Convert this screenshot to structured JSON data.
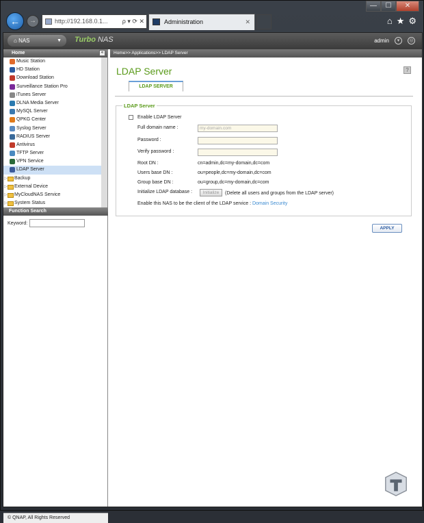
{
  "browser": {
    "address": "http://192.168.0.1...",
    "address_controls": "ρ ▾ ⟳ ✕",
    "tab_title": "Administration",
    "tab_close": "✕",
    "back_icon": "back-arrow-icon",
    "window_controls": [
      "—",
      "☐",
      "✕"
    ],
    "toolbar_icons": [
      "⌂",
      "★",
      "⚙"
    ]
  },
  "header": {
    "nas_button": "NAS",
    "logo_turbo": "Turbo",
    "logo_nas": "NAS",
    "user": "admin"
  },
  "sidebar": {
    "title": "Home",
    "apps": [
      {
        "label": "Music Station",
        "color": "#e06a2a"
      },
      {
        "label": "HD Station",
        "color": "#2a5aa0"
      },
      {
        "label": "Download Station",
        "color": "#c0392b"
      },
      {
        "label": "Surveillance Station Pro",
        "color": "#7a2a9a"
      },
      {
        "label": "iTunes Server",
        "color": "#888888"
      },
      {
        "label": "DLNA Media Server",
        "color": "#2a7ab0"
      },
      {
        "label": "MySQL Server",
        "color": "#3a7ab0"
      },
      {
        "label": "QPKG Center",
        "color": "#e07a1a"
      },
      {
        "label": "Syslog Server",
        "color": "#5a8ac0"
      },
      {
        "label": "RADIUS Server",
        "color": "#3a6a9a"
      },
      {
        "label": "Antivirus",
        "color": "#c03a2a"
      },
      {
        "label": "TFTP Server",
        "color": "#4a8ac0"
      },
      {
        "label": "VPN Service",
        "color": "#2a6a3a"
      },
      {
        "label": "LDAP Server",
        "color": "#3a5a9a",
        "selected": true
      }
    ],
    "folders": [
      "Backup",
      "External Device",
      "MyCloudNAS Service",
      "System Status"
    ],
    "function_search": "Function Search",
    "keyword_label": "Keyword:",
    "footer": "© QNAP, All Rights Reserved"
  },
  "main": {
    "breadcrumb": "Home>> Applications>> LDAP Server",
    "title": "LDAP Server",
    "tab": "LDAP SERVER",
    "legend": "LDAP Server",
    "enable_label": "Enable LDAP Server",
    "full_domain_label": "Full domain name :",
    "full_domain_placeholder": "my-domain.com",
    "password_label": "Password :",
    "verify_label": "Verify password :",
    "root_dn_label": "Root DN :",
    "root_dn": "cn=admin,dc=my-domain,dc=com",
    "users_dn_label": "Users base DN :",
    "users_dn": "ou=people,dc=my-domain,dc=com",
    "group_dn_label": "Group base DN :",
    "group_dn": "ou=group,dc=my-domain,dc=com",
    "init_label": "Initialize LDAP database :",
    "init_button": "Initialize",
    "init_note": "(Delete all users and groups from the LDAP server)",
    "client_text": "Enable this NAS to be the client of the LDAP service :",
    "client_link": "Domain Security",
    "apply": "APPLY",
    "help": "?"
  }
}
